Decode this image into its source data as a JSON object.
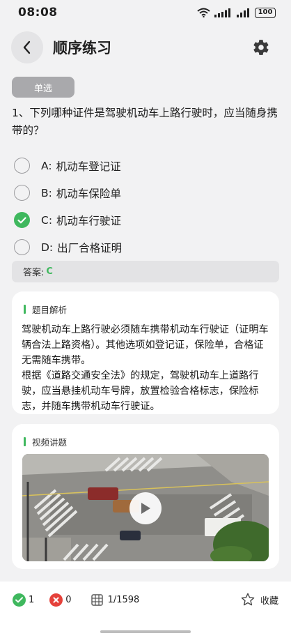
{
  "status": {
    "time": "08:08",
    "battery": "100",
    "icons": [
      "wifi-icon",
      "signal-icon",
      "signal-icon",
      "battery-icon"
    ]
  },
  "header": {
    "title": "顺序练习",
    "back_icon": "chevron-left-icon",
    "settings_icon": "gear-icon"
  },
  "question": {
    "type": "单选",
    "text": "1、下列哪种证件是驾驶机动车上路行驶时，应当随身携带的？",
    "options": [
      {
        "letter": "A:",
        "text": "机动车登记证",
        "selected": false
      },
      {
        "letter": "B:",
        "text": "机动车保险单",
        "selected": false
      },
      {
        "letter": "C:",
        "text": "机动车行驶证",
        "selected": true
      },
      {
        "letter": "D:",
        "text": "出厂合格证明",
        "selected": false
      }
    ]
  },
  "answer": {
    "label": "答案:",
    "value": "C"
  },
  "analysis": {
    "title": "题目解析",
    "paragraphs": [
      "驾驶机动车上路行驶必须随车携带机动车行驶证（证明车辆合法上路资格）。其他选项如登记证，保险单，合格证无需随车携带。",
      "根据《道路交通安全法》的规定，驾驶机动车上道路行驶，应当悬挂机动车号牌，放置检验合格标志，保险标志，并随车携带机动车行驶证。"
    ]
  },
  "video": {
    "title": "视频讲题",
    "play_icon": "play-icon"
  },
  "bottom": {
    "correct_count": "1",
    "wrong_count": "0",
    "progress": "1/1598",
    "favorite_label": "收藏"
  },
  "colors": {
    "accent": "#3fb85e",
    "wrong": "#e5413a",
    "background": "#f2f2f3"
  }
}
